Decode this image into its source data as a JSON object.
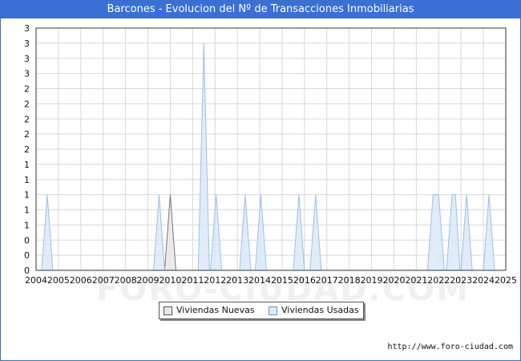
{
  "title": "Barcones - Evolucion del Nº de Transacciones Inmobiliarias",
  "watermark": "FORO-CIUDAD.COM",
  "source": "http://www.foro-ciudad.com",
  "colors": {
    "title_bg": "#3a6fd6",
    "nuevas_fill": "#e8e8e8",
    "nuevas_line": "#777777",
    "usadas_fill": "#dbe9f8",
    "usadas_line": "#9cc0ea",
    "grid": "#d8d8d8"
  },
  "chart_data": {
    "type": "area",
    "title": "Barcones - Evolucion del Nº de Transacciones Inmobiliarias",
    "xlabel": "",
    "ylabel": "",
    "xlim": [
      2004,
      2025
    ],
    "ylim": [
      0,
      3.2
    ],
    "y_ticks": [
      0,
      0.2,
      0.4,
      0.6,
      0.8,
      1.0,
      1.2,
      1.4,
      1.6,
      1.8,
      2.0,
      2.2,
      2.4,
      2.6,
      2.8,
      3.0,
      3.2
    ],
    "y_tick_labels": [
      "0",
      "0",
      "0",
      "1",
      "1",
      "1",
      "1",
      "1",
      "2",
      "2",
      "2",
      "2",
      "2",
      "3",
      "3",
      "3",
      "3"
    ],
    "x_tick_labels": [
      "2004",
      "2005",
      "2006",
      "2007",
      "2008",
      "2009",
      "2010",
      "2011",
      "2012",
      "2013",
      "2014",
      "2015",
      "2016",
      "2017",
      "2018",
      "2019",
      "2020",
      "2021",
      "2022",
      "2023",
      "2024",
      "2025"
    ],
    "grid": true,
    "legend_position": "bottom",
    "series": [
      {
        "name": "Viviendas Nuevas",
        "points": [
          [
            2009.75,
            0
          ],
          [
            2010.0,
            1
          ],
          [
            2010.25,
            0
          ]
        ]
      },
      {
        "name": "Viviendas Usadas",
        "points": [
          [
            2004.25,
            0
          ],
          [
            2004.5,
            1
          ],
          [
            2004.75,
            0
          ],
          [
            2009.25,
            0
          ],
          [
            2009.5,
            1
          ],
          [
            2009.75,
            0
          ],
          [
            2011.25,
            0
          ],
          [
            2011.5,
            3
          ],
          [
            2011.75,
            0
          ],
          [
            2011.8,
            0
          ],
          [
            2012.05,
            1
          ],
          [
            2012.3,
            0
          ],
          [
            2013.1,
            0
          ],
          [
            2013.35,
            1
          ],
          [
            2013.6,
            0
          ],
          [
            2013.8,
            0
          ],
          [
            2014.05,
            1
          ],
          [
            2014.3,
            0
          ],
          [
            2015.5,
            0
          ],
          [
            2015.75,
            1
          ],
          [
            2016.0,
            0
          ],
          [
            2016.25,
            0
          ],
          [
            2016.5,
            1
          ],
          [
            2016.75,
            0
          ],
          [
            2021.5,
            0
          ],
          [
            2021.75,
            1
          ],
          [
            2022.0,
            1
          ],
          [
            2022.25,
            0
          ],
          [
            2022.35,
            0
          ],
          [
            2022.6,
            1
          ],
          [
            2022.75,
            1
          ],
          [
            2022.95,
            0
          ],
          [
            2023.0,
            0
          ],
          [
            2023.25,
            1
          ],
          [
            2023.5,
            0
          ],
          [
            2024.0,
            0
          ],
          [
            2024.25,
            1
          ],
          [
            2024.5,
            0
          ]
        ]
      }
    ]
  },
  "legend": {
    "nuevas": "Viviendas Nuevas",
    "usadas": "Viviendas Usadas"
  }
}
